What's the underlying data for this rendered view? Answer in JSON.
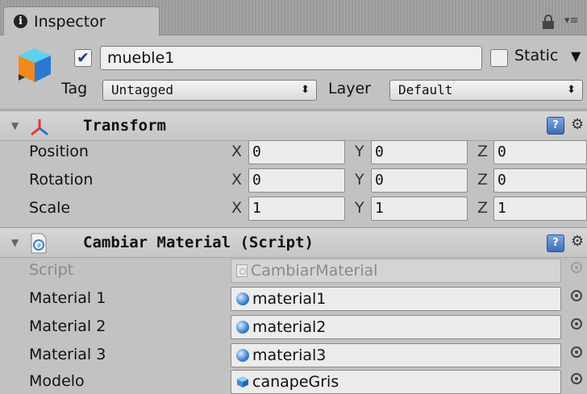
{
  "tab": {
    "title": "Inspector"
  },
  "object": {
    "name": "mueble1",
    "active": true,
    "static_label": "Static",
    "static": false
  },
  "tag": {
    "label": "Tag",
    "value": "Untagged"
  },
  "layer": {
    "label": "Layer",
    "value": "Default"
  },
  "transform": {
    "title": "Transform",
    "rows": [
      {
        "label": "Position",
        "x": "0",
        "y": "0",
        "z": "0"
      },
      {
        "label": "Rotation",
        "x": "0",
        "y": "0",
        "z": "0"
      },
      {
        "label": "Scale",
        "x": "1",
        "y": "1",
        "z": "1"
      }
    ],
    "axes": {
      "x": "X",
      "y": "Y",
      "z": "Z"
    }
  },
  "script_component": {
    "title": "Cambiar Material (Script)",
    "rows": [
      {
        "label": "Script",
        "value": "CambiarMaterial",
        "icon": "script-file-icon"
      },
      {
        "label": "Material 1",
        "value": "material1",
        "icon": "material-sphere-icon"
      },
      {
        "label": "Material 2",
        "value": "material2",
        "icon": "material-sphere-icon"
      },
      {
        "label": "Material 3",
        "value": "material3",
        "icon": "material-sphere-icon"
      },
      {
        "label": "Modelo",
        "value": "canapeGris",
        "icon": "mesh-cube-icon"
      }
    ]
  },
  "colors": {
    "panel": "#c2c2c2",
    "help_icon": "#3e6cb8",
    "check": "#1d3b8a"
  }
}
